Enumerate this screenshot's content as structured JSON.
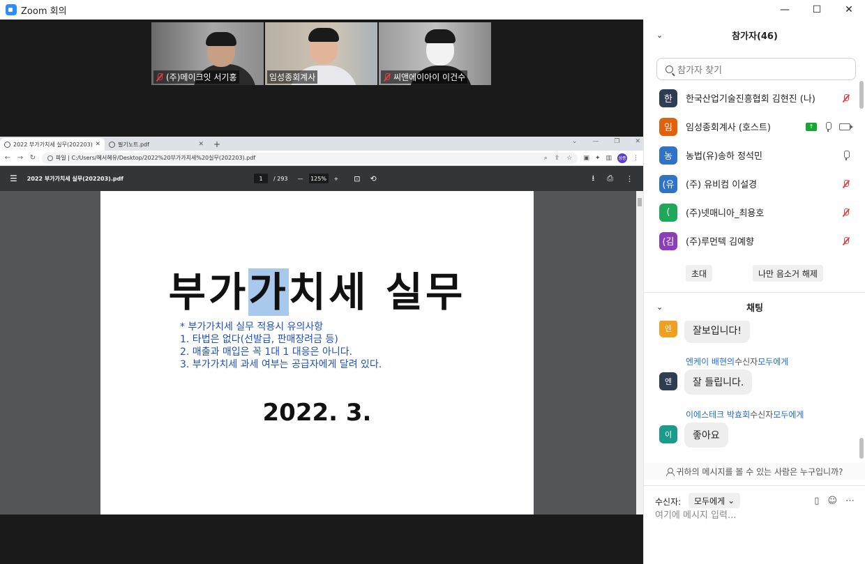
{
  "window": {
    "title": "Zoom 회의",
    "minimize": "—",
    "maximize": "☐",
    "close": "✕"
  },
  "videos": [
    {
      "name": "(주)메이크잇 서기홍",
      "muted": true
    },
    {
      "name": "임성종회계사",
      "muted": false
    },
    {
      "name": "씨앤에이아이 이건수",
      "muted": true
    }
  ],
  "browser": {
    "tabs": [
      {
        "label": "2022 부가가치세 실무(202203).p",
        "close": "✕"
      },
      {
        "label": "필기노트.pdf",
        "close": "✕"
      }
    ],
    "new_tab": "+",
    "address": "파일 | C:/Users/혜서혜유/Desktop/2022%20부가가치세%20실무(202203).pdf",
    "profile_initials": "성종"
  },
  "pdf": {
    "doc_title": "2022 부가가치세 실무(202203).pdf",
    "page_current": "1",
    "page_total": "/ 293",
    "zoom": "125%",
    "slide_title_before": "부가",
    "slide_title_selected": "가",
    "slide_title_after": "치세 실무",
    "notes": [
      "* 부가가치세 실무 적용시 유의사항",
      "1. 타법은 없다(선발급, 판매장려금 등)",
      "2. 매출과 매입은 꼭 1대 1 대응은 아니다.",
      "3. 부가가치세 과세 여부는 공급자에게 달려 있다."
    ],
    "slide_date": "2022. 3."
  },
  "participants": {
    "header": "참가자(46)",
    "search_placeholder": "참가자 찾기",
    "items": [
      {
        "initial": "한",
        "name": "한국산업기술진흥협회 김현진 (나)",
        "color": "#2e3d52",
        "mic": "off",
        "share": false,
        "cam": false
      },
      {
        "initial": "임",
        "name": "임성종회계사 (호스트)",
        "color": "#e0620c",
        "mic": "on",
        "share": true,
        "cam": true
      },
      {
        "initial": "농",
        "name": "농법(유)송하 정석민",
        "color": "#2f73c9",
        "mic": "on",
        "share": false,
        "cam": false
      },
      {
        "initial": "(유",
        "name": "(주) 유비컴 이설경",
        "color": "#2f73c9",
        "mic": "off",
        "share": false,
        "cam": false
      },
      {
        "initial": "(",
        "name": "(주)넷매니아_최용호",
        "color": "#20a85a",
        "mic": "off",
        "share": false,
        "cam": false
      },
      {
        "initial": "(김",
        "name": "(주)루먼텍 김예향",
        "color": "#8a3fb8",
        "mic": "off",
        "share": false,
        "cam": false
      }
    ],
    "invite_label": "초대",
    "unmute_me_label": "나만 음소거 해제"
  },
  "chat": {
    "header": "채팅",
    "messages": [
      {
        "avatar": "엔",
        "color": "#f0a020",
        "sender": "",
        "to_label": "",
        "to": "",
        "text": "잘보입니다!"
      },
      {
        "avatar": "엔",
        "color": "#2e3d52",
        "sender": "엔케이 배현의",
        "to_label": "수신자",
        "to": "모두에게",
        "text": "잘 들립니다."
      },
      {
        "avatar": "이",
        "color": "#1a9c8c",
        "sender": "이에스테크 박효회",
        "to_label": "수신자",
        "to": "모두에게",
        "text": "좋아요"
      }
    ],
    "privacy_note": "귀하의 메시지를 볼 수 있는 사람은 누구입니까?",
    "to_label": "수신자:",
    "to_value": "모두에게",
    "compose_placeholder": "여기에 메시지 입력..."
  }
}
